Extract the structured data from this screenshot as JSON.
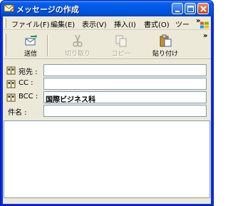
{
  "window": {
    "title": "メッセージの作成"
  },
  "menu": {
    "items": [
      {
        "label": "ファイル(F)"
      },
      {
        "label": "編集(E)"
      },
      {
        "label": "表示(V)"
      },
      {
        "label": "挿入(I)"
      },
      {
        "label": "書式(O)"
      },
      {
        "label": "ツー"
      }
    ],
    "more": "»"
  },
  "toolbar": {
    "buttons": [
      {
        "label": "送信",
        "icon": "send-icon",
        "enabled": true
      },
      {
        "label": "切り取り",
        "icon": "scissors-icon",
        "enabled": false
      },
      {
        "label": "コピー",
        "icon": "copy-icon",
        "enabled": false
      },
      {
        "label": "貼り付け",
        "icon": "paste-icon",
        "enabled": true
      }
    ],
    "more": "»"
  },
  "fields": {
    "to": {
      "label": "宛先 :",
      "value": "",
      "icon": "address-book-icon"
    },
    "cc": {
      "label": "CC :",
      "value": "",
      "icon": "address-book-icon"
    },
    "bcc": {
      "label": "BCC :",
      "value": "国際ビジネス科",
      "icon": "address-book-icon"
    },
    "subject": {
      "label": "件名 :",
      "value": ""
    }
  },
  "body": {
    "text": ""
  },
  "colors": {
    "titlebar": "#0058e6",
    "chrome": "#ece9d8",
    "input_border": "#7f9db9"
  }
}
